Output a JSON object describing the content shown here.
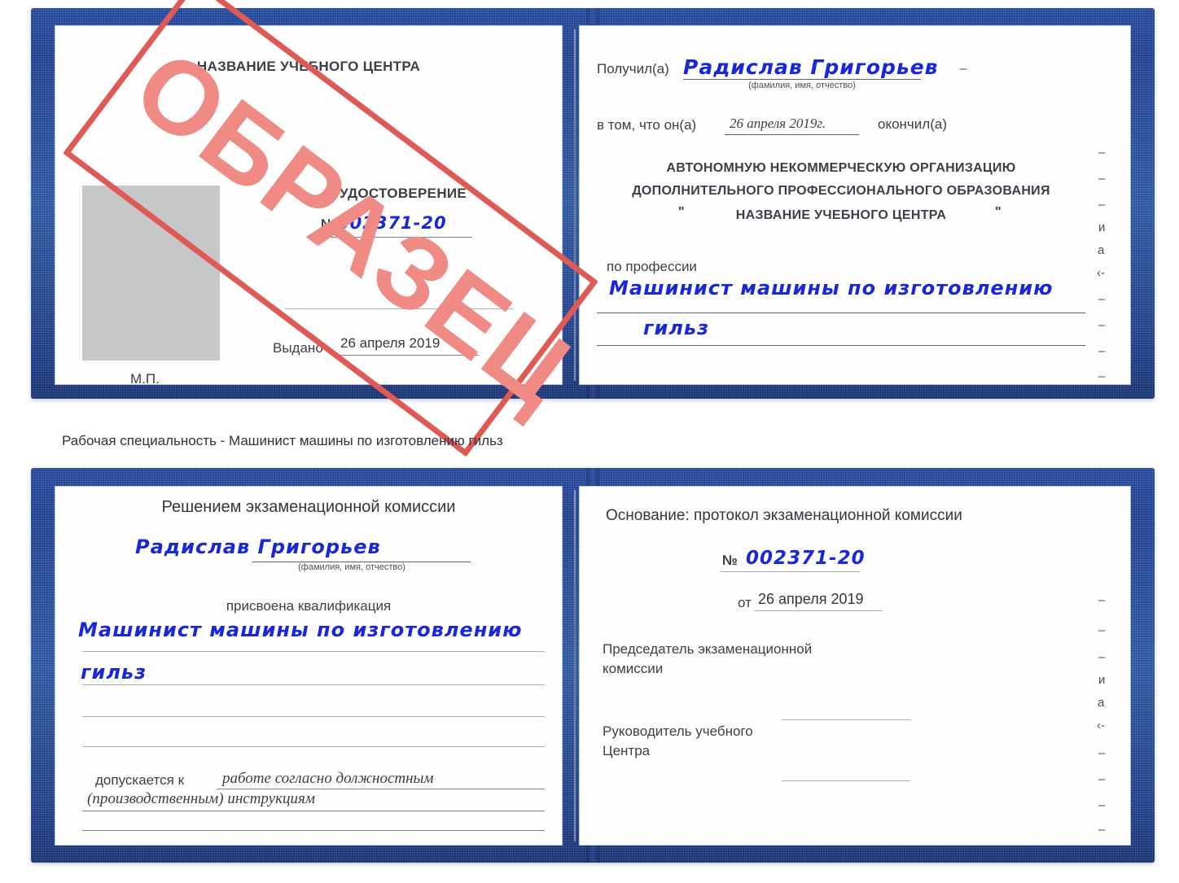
{
  "document": {
    "kind": "Удостоверение (свидетельство) о рабочей профессии — образец",
    "caption": "Рабочая специальность - Машинист машины по изготовлению гильз",
    "watermark": "ОБРАЗЕЦ",
    "accent_blue": "#1d3f8e",
    "ink_blue": "#1a27d8",
    "stamp_red": "#e05a55",
    "stamp_red_light": "#ef8a85",
    "photo_gray": "#c6c7c9"
  },
  "certificate_top": {
    "left_page": {
      "org_title": "НАЗВАНИЕ УЧЕБНОГО ЦЕНТРА",
      "doc_type": "УДОСТОВЕРЕНИЕ",
      "number_label": "№",
      "number_value": "002371-20",
      "issued_label": "Выдано",
      "issued_value": "26 апреля 2019",
      "seal_label": "М.П."
    },
    "right_page": {
      "received_label": "Получил(а)",
      "received_value": "Радислав Григорьев",
      "name_hint": "(фамилия, имя, отчество)",
      "that_he_label": "в том, что он(а)",
      "that_he_date": "26 апреля 2019г.",
      "finished_label": "окончил(а)",
      "org_line_1": "АВТОНОМНУЮ НЕКОММЕРЧЕСКУЮ ОРГАНИЗАЦИЮ",
      "org_line_2": "ДОПОЛНИТЕЛЬНОГО ПРОФЕССИОНАЛЬНОГО ОБРАЗОВАНИЯ",
      "org_quote_open": "\"",
      "org_line_3": "НАЗВАНИЕ УЧЕБНОГО ЦЕНТРА",
      "org_quote_close": "\"",
      "profession_label": "по профессии",
      "profession_value_1": "Машинист машины по изготовлению",
      "profession_value_2": "гильз",
      "edge_glyphs": [
        "–",
        "–",
        "–",
        "и",
        "а",
        "‹-",
        "–",
        "–",
        "–",
        "–"
      ]
    }
  },
  "certificate_bottom": {
    "left_page": {
      "decision_title": "Решением экзаменационной комиссии",
      "name_value": "Радислав Григорьев",
      "name_hint": "(фамилия, имя, отчество)",
      "qualification_label": "присвоена квалификация",
      "qualification_value_1": "Машинист машины по изготовлению",
      "qualification_value_2": "гильз",
      "allowed_label": "допускается к",
      "allowed_value_1": "работе согласно должностным",
      "allowed_value_2": "(производственным) инструкциям"
    },
    "right_page": {
      "basis_label": "Основание: протокол экзаменационной комиссии",
      "number_label": "№",
      "number_value": "002371-20",
      "date_label": "от",
      "date_value": "26 апреля 2019",
      "chairman_line_1": "Председатель экзаменационной",
      "chairman_line_2": "комиссии",
      "head_line_1": "Руководитель учебного",
      "head_line_2": "Центра",
      "edge_glyphs": [
        "–",
        "–",
        "–",
        "и",
        "а",
        "‹-",
        "–",
        "–",
        "–",
        "–"
      ]
    }
  }
}
